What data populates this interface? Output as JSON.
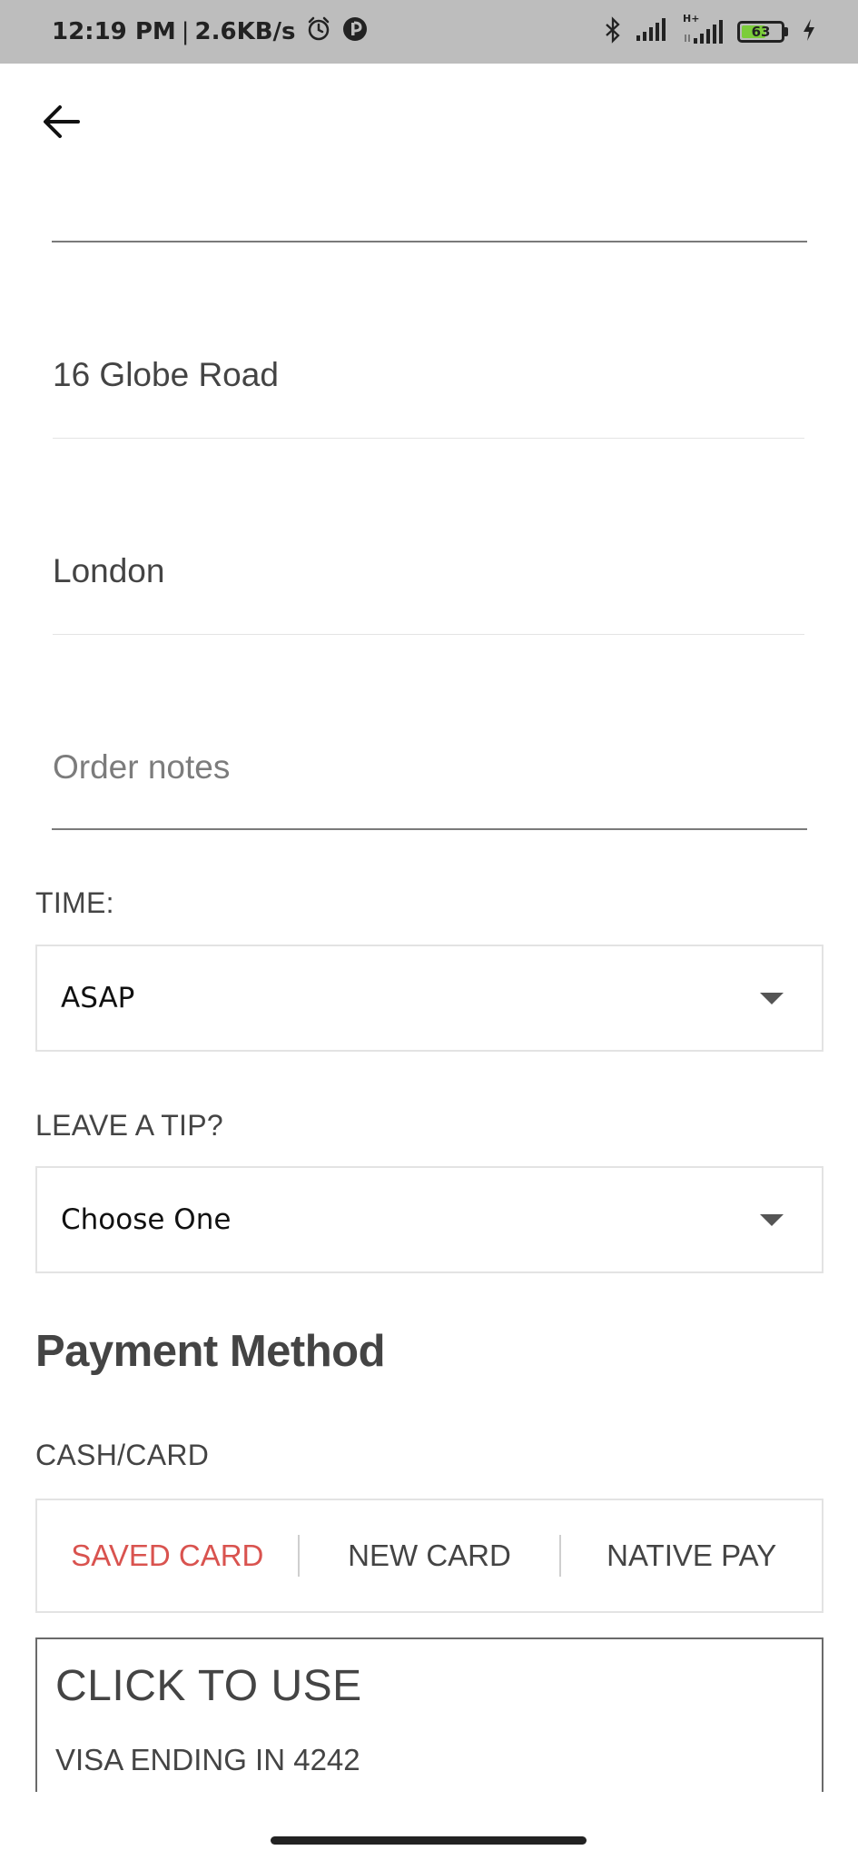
{
  "status_bar": {
    "time": "12:19 PM",
    "separator": "|",
    "speed": "2.6KB/s",
    "battery_level": "63",
    "battery_fraction": 0.63,
    "network_label": "H+",
    "icons": [
      "alarm-icon",
      "app-notification-icon",
      "bluetooth-icon",
      "signal-icon",
      "signal-hplus-icon",
      "battery-icon",
      "charging-icon"
    ]
  },
  "nav": {
    "back_icon": "arrow-left-icon"
  },
  "form": {
    "address_value": "16 Globe Road",
    "city_value": "London",
    "notes_value": "",
    "notes_placeholder": "Order notes"
  },
  "time": {
    "label": "TIME:",
    "selected": "ASAP"
  },
  "tip": {
    "label": "LEAVE A TIP?",
    "selected": "Choose One"
  },
  "payment": {
    "title": "Payment Method",
    "subtitle": "CASH/CARD",
    "tabs": [
      {
        "label": "SAVED CARD",
        "active": true
      },
      {
        "label": "NEW CARD",
        "active": false
      },
      {
        "label": "NATIVE PAY",
        "active": false
      }
    ],
    "active_color": "#d9534f",
    "card": {
      "title": "CLICK TO USE",
      "detail": "VISA ENDING IN 4242"
    }
  }
}
